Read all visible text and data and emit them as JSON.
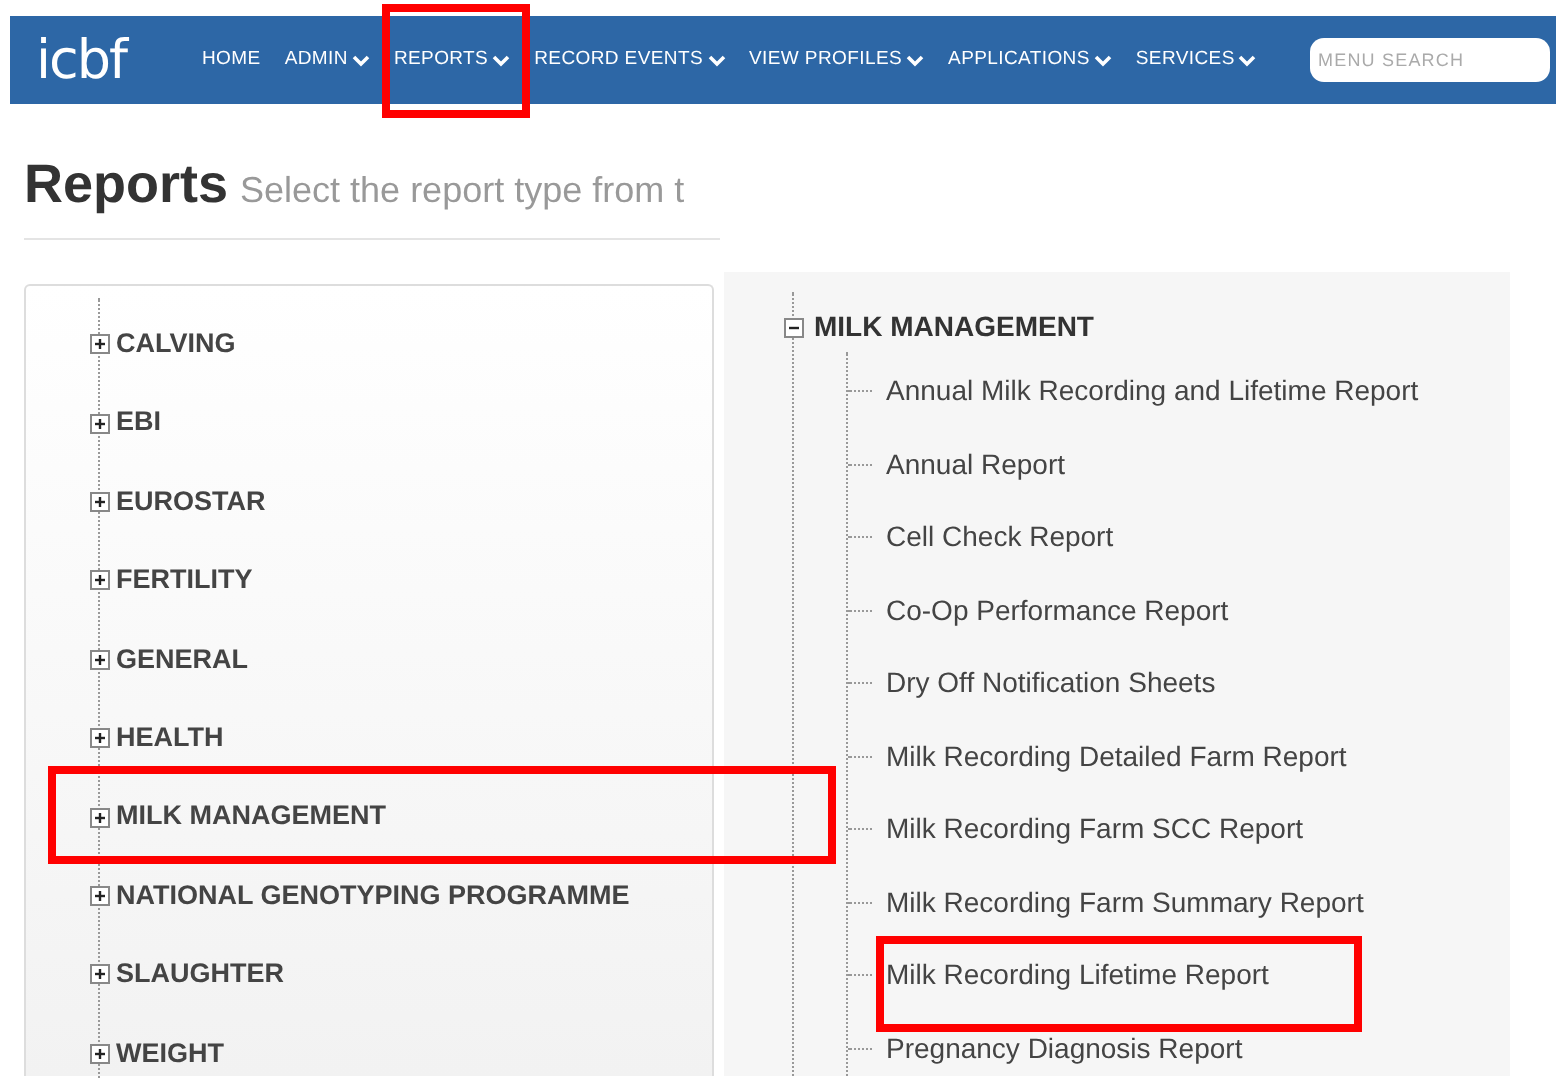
{
  "navbar": {
    "logo": "icbf",
    "items": [
      {
        "label": "HOME",
        "dropdown": false,
        "highlighted": false
      },
      {
        "label": "ADMIN",
        "dropdown": true,
        "highlighted": false
      },
      {
        "label": "REPORTS",
        "dropdown": true,
        "highlighted": true
      },
      {
        "label": "RECORD EVENTS",
        "dropdown": true,
        "highlighted": false
      },
      {
        "label": "VIEW PROFILES",
        "dropdown": true,
        "highlighted": false
      },
      {
        "label": "APPLICATIONS",
        "dropdown": true,
        "highlighted": false
      },
      {
        "label": "SERVICES",
        "dropdown": true,
        "highlighted": false
      }
    ],
    "search": {
      "placeholder": "MENU SEARCH"
    }
  },
  "page": {
    "title": "Reports",
    "subtitle": "Select the report type from t"
  },
  "categories": [
    {
      "label": "CALVING",
      "expanded": false,
      "highlighted": false
    },
    {
      "label": "EBI",
      "expanded": false,
      "highlighted": false
    },
    {
      "label": "EUROSTAR",
      "expanded": false,
      "highlighted": false
    },
    {
      "label": "FERTILITY",
      "expanded": false,
      "highlighted": false
    },
    {
      "label": "GENERAL",
      "expanded": false,
      "highlighted": false
    },
    {
      "label": "HEALTH",
      "expanded": false,
      "highlighted": false
    },
    {
      "label": "MILK MANAGEMENT",
      "expanded": false,
      "highlighted": true
    },
    {
      "label": "NATIONAL GENOTYPING PROGRAMME",
      "expanded": false,
      "highlighted": false
    },
    {
      "label": "SLAUGHTER",
      "expanded": false,
      "highlighted": false
    },
    {
      "label": "WEIGHT",
      "expanded": false,
      "highlighted": false
    }
  ],
  "report_tree": {
    "label": "MILK MANAGEMENT",
    "expanded": true,
    "children": [
      {
        "label": "Annual Milk Recording and Lifetime Report",
        "highlighted": false
      },
      {
        "label": "Annual Report",
        "highlighted": false
      },
      {
        "label": "Cell Check Report",
        "highlighted": false
      },
      {
        "label": "Co-Op Performance Report",
        "highlighted": false
      },
      {
        "label": "Dry Off Notification Sheets",
        "highlighted": false
      },
      {
        "label": "Milk Recording Detailed Farm Report",
        "highlighted": false
      },
      {
        "label": "Milk Recording Farm SCC Report",
        "highlighted": false
      },
      {
        "label": "Milk Recording Farm Summary Report",
        "highlighted": false
      },
      {
        "label": "Milk Recording Lifetime Report",
        "highlighted": true
      },
      {
        "label": "Pregnancy Diagnosis Report",
        "highlighted": false
      }
    ]
  }
}
